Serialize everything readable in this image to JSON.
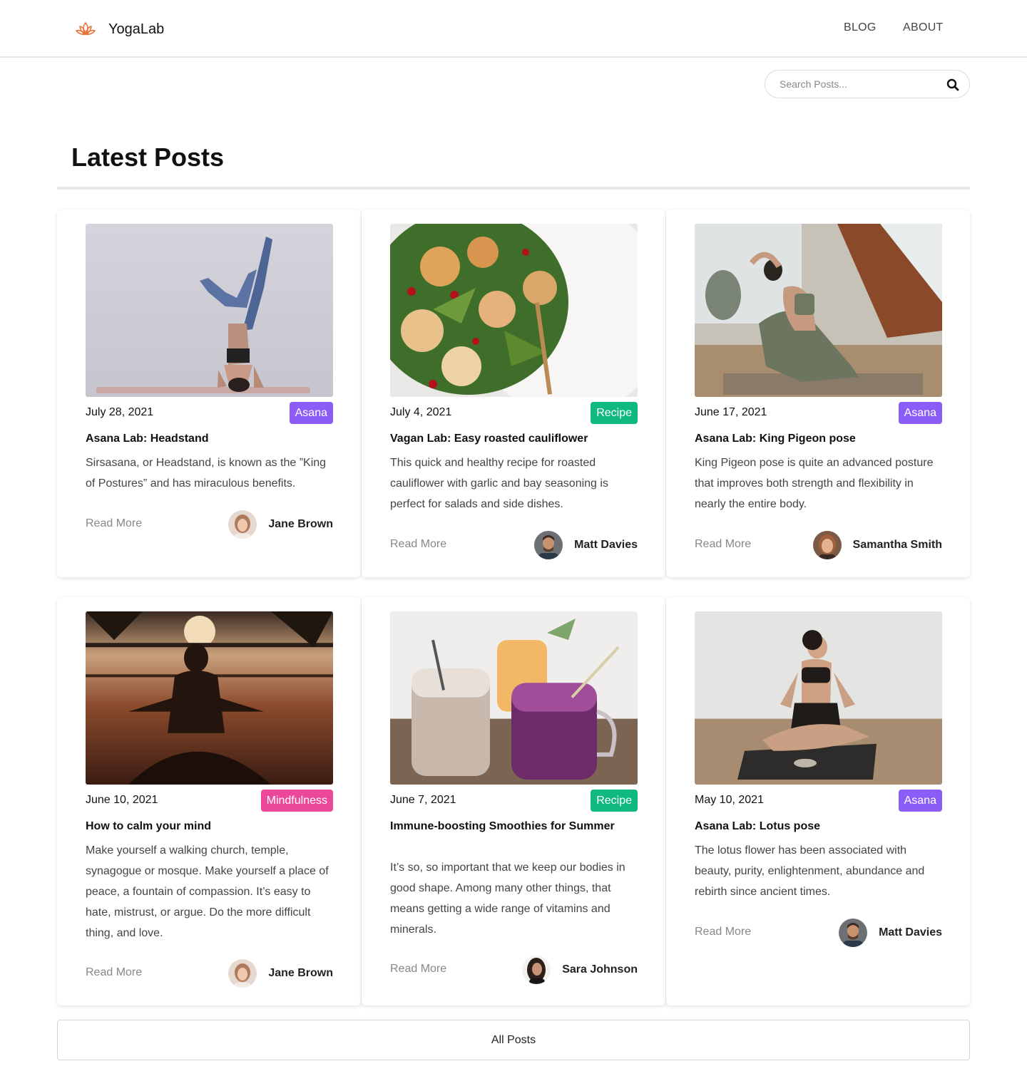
{
  "header": {
    "logo_icon": "lotus-icon",
    "brand": "YogaLab",
    "nav": [
      {
        "label": "BLOG"
      },
      {
        "label": "ABOUT"
      }
    ]
  },
  "search": {
    "placeholder": "Search Posts...",
    "value": "",
    "icon": "search-icon"
  },
  "main": {
    "title": "Latest Posts",
    "all_posts_label": "All Posts"
  },
  "colors": {
    "asana": "#8b5cf6",
    "recipe": "#10b981",
    "mindfulness": "#ec4899",
    "logo": "#e8733a"
  },
  "posts": [
    {
      "date": "July 28, 2021",
      "tag": "Asana",
      "title": "Asana Lab: Headstand",
      "excerpt": "Sirsasana, or Headstand, is known as the ”King of Postures” and has miraculous benefits.",
      "read_more": "Read More",
      "author": "Jane Brown",
      "image": "headstand-photo"
    },
    {
      "date": "July 4, 2021",
      "tag": "Recipe",
      "title": "Vagan Lab: Easy roasted cauliflower",
      "excerpt": "This quick and healthy recipe for roasted cauliflower with garlic and bay seasoning is perfect for salads and side dishes.",
      "read_more": "Read More",
      "author": "Matt Davies",
      "image": "cauliflower-salad-photo"
    },
    {
      "date": "June 17, 2021",
      "tag": "Asana",
      "title": "Asana Lab: King Pigeon pose",
      "excerpt": "King Pigeon pose is quite an advanced posture that improves both strength and flexibility in nearly the entire body.",
      "read_more": "Read More",
      "author": "Samantha Smith",
      "image": "king-pigeon-photo"
    },
    {
      "date": "June 10, 2021",
      "tag": "Mindfulness",
      "title": "How to calm your mind",
      "excerpt": "Make yourself a walking church, temple, synagogue or mosque. Make yourself a place of peace, a fountain of compassion. It’s easy to hate, mistrust, or argue. Do the more difficult thing, and love.",
      "read_more": "Read More",
      "author": "Jane Brown",
      "image": "meditation-sunset-photo"
    },
    {
      "date": "June 7, 2021",
      "tag": "Recipe",
      "title": "Immune-boosting Smoothies for Summer",
      "excerpt": "It’s so, so important that we keep our bodies in good shape. Among many other things, that means getting a wide range of vitamins and minerals.",
      "read_more": "Read More",
      "author": "Sara Johnson",
      "image": "smoothies-photo"
    },
    {
      "date": "May 10, 2021",
      "tag": "Asana",
      "title": "Asana Lab: Lotus pose",
      "excerpt": "The lotus flower has been associated with beauty, purity, enlightenment, abundance and rebirth since ancient times.",
      "read_more": "Read More",
      "author": "Matt Davies",
      "image": "lotus-pose-photo"
    }
  ]
}
